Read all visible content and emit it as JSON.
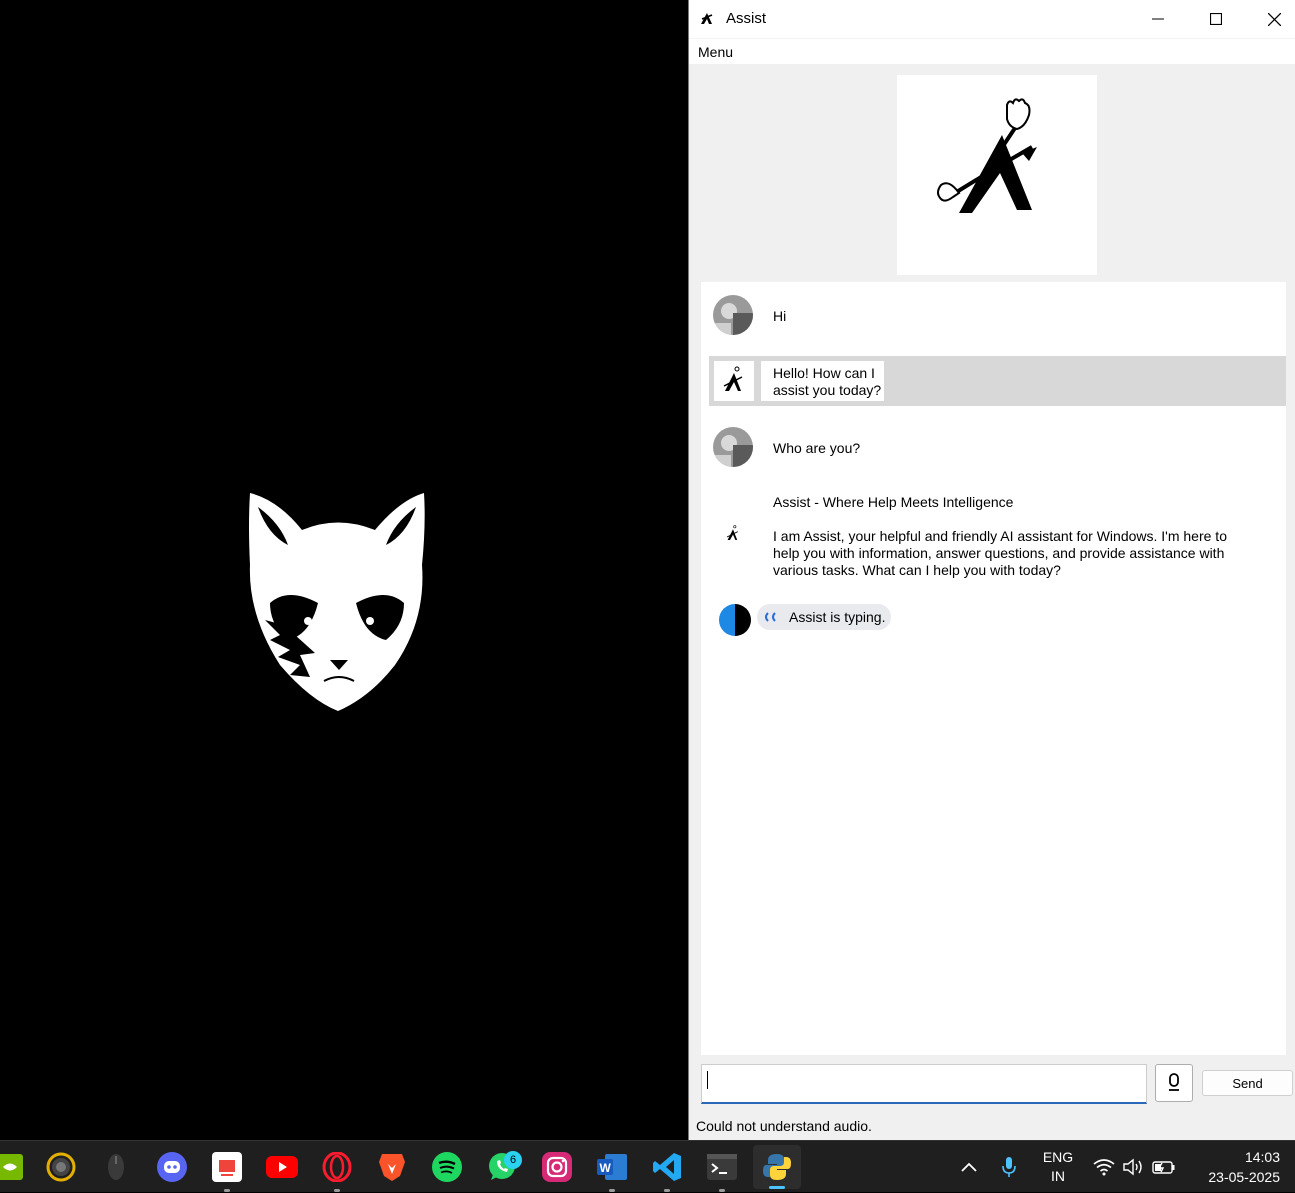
{
  "window": {
    "title": "Assist",
    "menu": "Menu"
  },
  "chat": {
    "messages": [
      {
        "sender": "user",
        "text": "Hi"
      },
      {
        "sender": "assist",
        "line1": "Hello! How can I",
        "line2": "assist you today?"
      },
      {
        "sender": "user",
        "text": "Who are you?"
      },
      {
        "sender": "assist",
        "heading": "Assist - Where Help Meets Intelligence",
        "line1": "I am Assist, your helpful and friendly AI assistant for Windows. I'm here to",
        "line2": "help you with information, answer questions, and provide assistance with",
        "line3": "various tasks. What can I help you with today?"
      }
    ],
    "typing": "Assist is typing."
  },
  "composer": {
    "input_value": "",
    "mic_icon": "microphone-icon",
    "send_label": "Send"
  },
  "status": "Could not understand audio.",
  "taskbar": {
    "apps": [
      "nvidia-icon",
      "color-app-icon",
      "mouse-app-icon",
      "discord-icon",
      "anydesk-icon",
      "youtube-icon",
      "opera-icon",
      "brave-icon",
      "spotify-icon",
      "whatsapp-icon",
      "instagram-icon",
      "word-icon",
      "vscode-icon",
      "terminal-icon",
      "python-icon"
    ],
    "whatsapp_badge": "6",
    "lang_line1": "ENG",
    "lang_line2": "IN",
    "time": "14:03",
    "date": "23-05-2025"
  },
  "colors": {
    "accent": "#2b68b8",
    "taskbar_bg": "#1f1f1f",
    "assist_row_bg": "#d8d8d8",
    "badge": "#2ad2f0"
  }
}
